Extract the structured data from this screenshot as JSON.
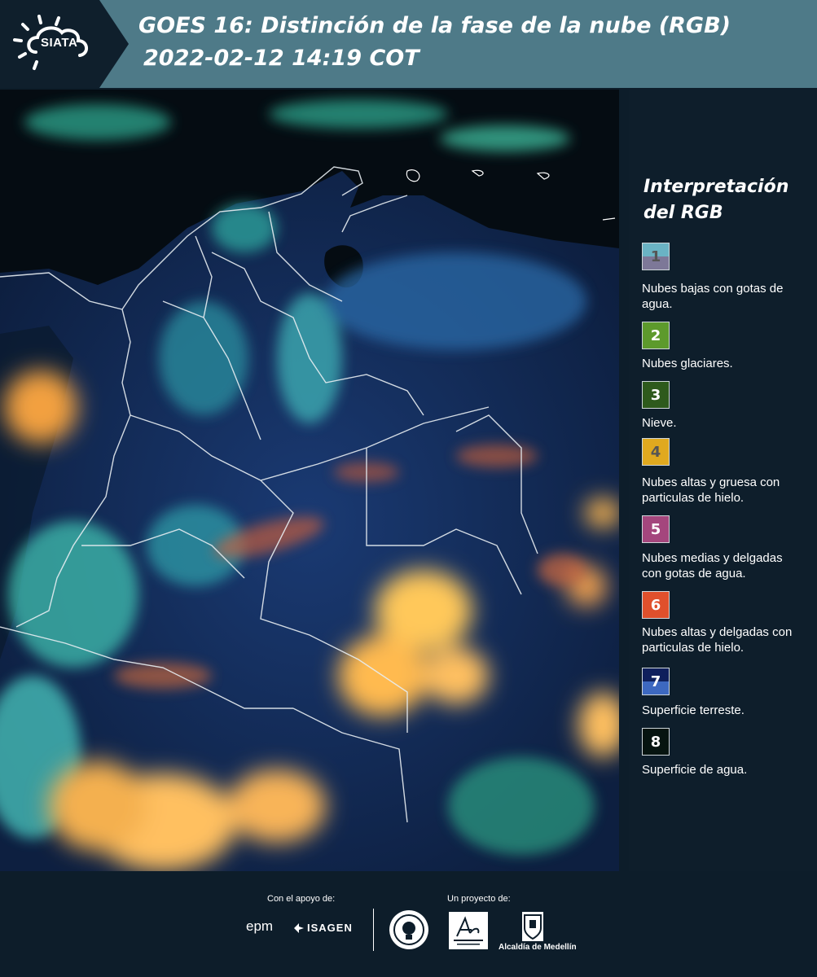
{
  "header": {
    "brand": "SIATA",
    "title_line1": "GOES 16: Distinción de la fase de la nube (RGB)",
    "title_line2": "2022-02-12 14:19 COT"
  },
  "legend": {
    "title": "Interpretación del RGB",
    "items": [
      {
        "number": "1",
        "label": "Nubes bajas con gotas de agua.",
        "color_top": "#6ab3c4",
        "color_bottom": "#7d7898",
        "text_color": "#555555"
      },
      {
        "number": "2",
        "label": "Nubes glaciares.",
        "color_top": "#5d9a2c",
        "color_bottom": "#5d9a2c",
        "text_color": "#ffffff"
      },
      {
        "number": "3",
        "label": "Nieve.",
        "color_top": "#2e5a1c",
        "color_bottom": "#2e5a1c",
        "text_color": "#ffffff"
      },
      {
        "number": "4",
        "label": "Nubes altas y gruesa con particulas de hielo.",
        "color_top": "#e0a91f",
        "color_bottom": "#e0a91f",
        "text_color": "#555555"
      },
      {
        "number": "5",
        "label": "Nubes medias y delgadas con gotas de agua.",
        "color_top": "#a4467d",
        "color_bottom": "#a4467d",
        "text_color": "#ffffff"
      },
      {
        "number": "6",
        "label": "Nubes altas y delgadas con particulas de hielo.",
        "color_top": "#e0502c",
        "color_bottom": "#e0502c",
        "text_color": "#ffffff"
      },
      {
        "number": "7",
        "label": "Superficie terreste.",
        "color_top": "#0f1f5c",
        "color_bottom": "#3d68c0",
        "text_color": "#ffffff"
      },
      {
        "number": "8",
        "label": "Superficie de agua.",
        "color_top": "#061410",
        "color_bottom": "#061410",
        "text_color": "#ffffff"
      }
    ]
  },
  "footer": {
    "support_label": "Con el apoyo de:",
    "project_label": "Un proyecto de:",
    "sponsor1": "epm",
    "sponsor2": "ISAGEN",
    "partner_alcaldia": "Alcaldía de Medellín"
  },
  "colors": {
    "header_bg": "#4e7a88",
    "panel_bg": "#0e1e2b"
  }
}
